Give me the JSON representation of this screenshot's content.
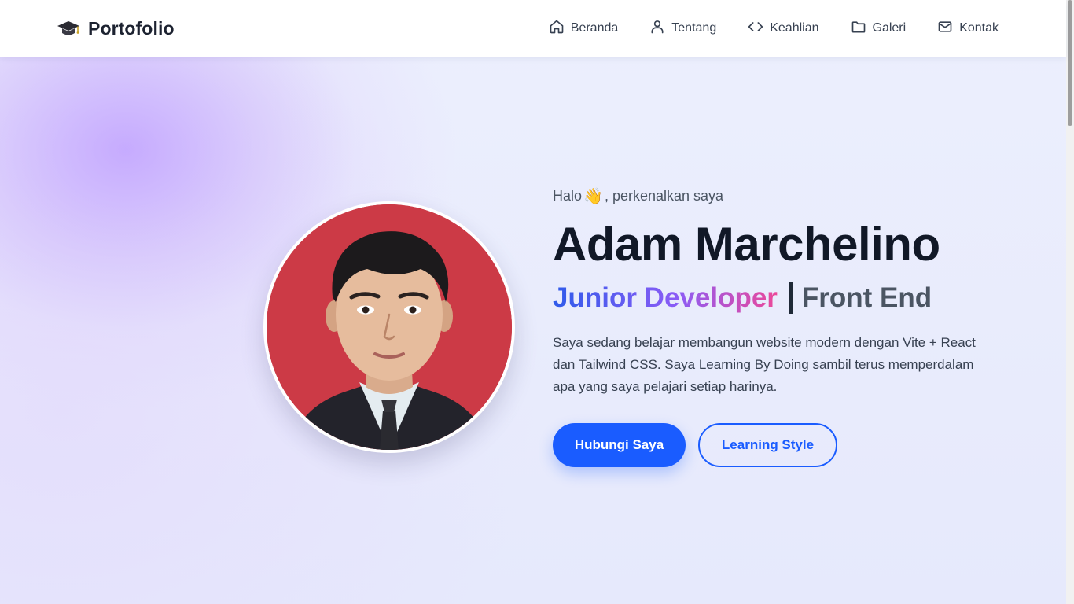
{
  "navbar": {
    "brand": {
      "icon": "graduation-cap-icon",
      "name": "Portofolio"
    },
    "links": [
      {
        "label": "Beranda",
        "icon": "home-icon"
      },
      {
        "label": "Tentang",
        "icon": "user-icon"
      },
      {
        "label": "Keahlian",
        "icon": "code-icon"
      },
      {
        "label": "Galeri",
        "icon": "folder-icon"
      },
      {
        "label": "Kontak",
        "icon": "mail-icon"
      }
    ]
  },
  "hero": {
    "greeting_before": "Halo",
    "greeting_emoji": "👋",
    "greeting_after": ", perkenalkan saya",
    "name": "Adam Marchelino",
    "role_highlight": "Junior Developer",
    "role_static": "Front End",
    "description": "Saya sedang belajar membangun website modern dengan Vite + React dan Tailwind CSS. Saya Learning By Doing sambil terus memperdalam apa yang saya pelajari setiap harinya.",
    "primary_button": "Hubungi Saya",
    "secondary_button": "Learning Style",
    "avatar": "profile-photo"
  },
  "colors": {
    "accent": "#1a5cff",
    "text_dark": "#111827",
    "gradient_start": "#2f5bea",
    "gradient_mid": "#8b5cf6",
    "gradient_end": "#ec4899",
    "photo_background": "#cc3a46"
  }
}
